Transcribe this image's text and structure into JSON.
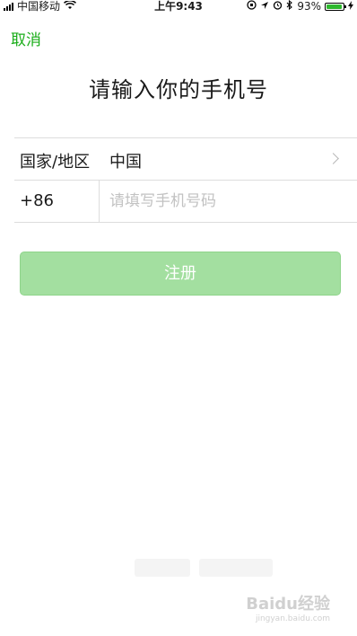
{
  "status_bar": {
    "carrier": "中国移动",
    "time": "上午9:43",
    "battery": "93%",
    "battery_level": 0.93
  },
  "nav": {
    "cancel_label": "取消"
  },
  "title": "请输入你的手机号",
  "country": {
    "label": "国家/地区",
    "value": "中国"
  },
  "phone": {
    "code": "+86",
    "placeholder": "请填写手机号码",
    "value": ""
  },
  "register_label": "注册",
  "colors": {
    "accent": "#1aad19",
    "button_disabled": "#a3dfa0"
  },
  "watermark": {
    "main": "Baidu经验",
    "sub": "jingyan.baidu.com"
  }
}
